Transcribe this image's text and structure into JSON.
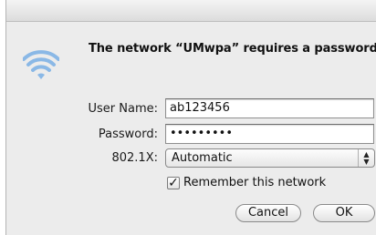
{
  "dialog": {
    "message": "The network “UMwpa” requires a password.",
    "icon": "wifi-icon"
  },
  "form": {
    "username_label": "User Name:",
    "username_value": "ab123456",
    "password_label": "Password:",
    "password_value": "•••••••••",
    "auth_label": "802.1X:",
    "auth_value": "Automatic",
    "remember_label": "Remember this network",
    "remember_checked": true
  },
  "buttons": {
    "cancel": "Cancel",
    "ok": "OK"
  },
  "colors": {
    "wifi": "#8ab8e6",
    "dialog_bg": "#ececec"
  }
}
